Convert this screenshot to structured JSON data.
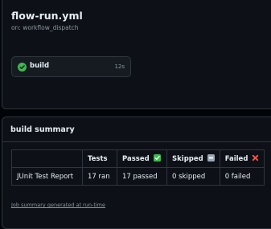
{
  "workflow": {
    "title": "flow-run.yml",
    "trigger": "on: workflow_dispatch",
    "job": {
      "name": "build",
      "duration": "12s",
      "status_icon": "check-circle-icon",
      "status_color": "#3fb950"
    }
  },
  "summary": {
    "heading": "build summary",
    "table": {
      "headers": [
        "",
        "Tests",
        "Passed",
        "Skipped",
        "Failed"
      ],
      "header_icons": [
        "",
        "",
        "white-check-mark-icon",
        "ignore-symbol-icon",
        "cross-mark-icon"
      ],
      "rows": [
        [
          "JUnit Test Report",
          "17 ran",
          "17 passed",
          "0 skipped",
          "0 failed"
        ]
      ]
    },
    "footer_link": "Job summary generated at run-time"
  },
  "colors": {
    "background": "#010409",
    "panel": "#0d1117",
    "border": "#30363d",
    "text": "#e6edf3",
    "muted": "#8d96a0",
    "success": "#3fb950",
    "fail": "#f85149"
  }
}
